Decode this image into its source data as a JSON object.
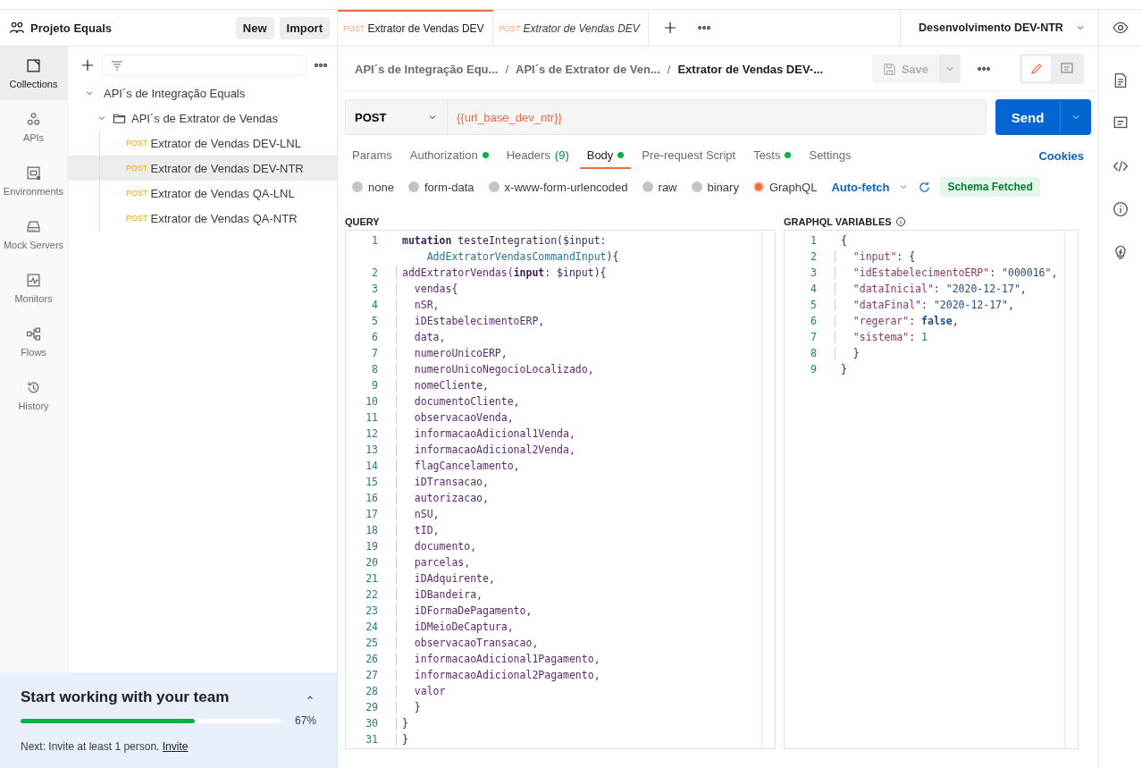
{
  "workspace": {
    "title": "Projeto Equals",
    "buttons": [
      "New",
      "Import"
    ]
  },
  "nav": [
    {
      "label": "Collections",
      "selected": true
    },
    {
      "label": "APIs",
      "selected": false
    },
    {
      "label": "Environments",
      "selected": false
    },
    {
      "label": "Mock Servers",
      "selected": false
    },
    {
      "label": "Monitors",
      "selected": false
    },
    {
      "label": "Flows",
      "selected": false
    },
    {
      "label": "History",
      "selected": false
    }
  ],
  "tree": [
    {
      "kind": "collection",
      "label": "API´s de Integração Equals",
      "expanded": true,
      "children": [
        {
          "kind": "folder",
          "label": "API´s de Extrator de Vendas",
          "expanded": true,
          "children": [
            {
              "kind": "request",
              "method": "POST",
              "label": "Extrator de Vendas DEV-LNL",
              "selected": false
            },
            {
              "kind": "request",
              "method": "POST",
              "label": "Extrator de Vendas DEV-NTR",
              "selected": true
            },
            {
              "kind": "request",
              "method": "POST",
              "label": "Extrator de Vendas QA-LNL",
              "selected": false
            },
            {
              "kind": "request",
              "method": "POST",
              "label": "Extrator de Vendas QA-NTR",
              "selected": false
            }
          ]
        }
      ]
    }
  ],
  "onboarding": {
    "title": "Start working with your team",
    "level": 0.67,
    "percent": "67%",
    "next": "Next: Invite at least 1 person.",
    "link": "Invite"
  },
  "open_tabs": [
    {
      "method": "POST",
      "label": "Extrator de Vendas DEV",
      "selected": true,
      "preview": false
    },
    {
      "method": "POST",
      "label": "Extrator de Vendas DEV",
      "selected": false,
      "preview": true
    }
  ],
  "environment": "Desenvolvimento DEV-NTR",
  "breadcrumb": {
    "items": [
      "API´s de Integração Equ...",
      "API´s de Extrator de Ven...",
      "Extrator de Vendas DEV-..."
    ],
    "separator": "/"
  },
  "save": {
    "label": "Save",
    "disabled": true
  },
  "request": {
    "method": "POST",
    "url": "{{url_base_dev_ntr}}",
    "send": "Send"
  },
  "request_tabs": [
    {
      "label": "Params",
      "dot": false,
      "selected": false
    },
    {
      "label": "Authorization",
      "dot": true,
      "selected": false
    },
    {
      "label": "Headers",
      "count": "(9)",
      "dot": false,
      "selected": false
    },
    {
      "label": "Body",
      "dot": true,
      "selected": true
    },
    {
      "label": "Pre-request Script",
      "dot": false,
      "selected": false
    },
    {
      "label": "Tests",
      "dot": true,
      "selected": false
    },
    {
      "label": "Settings",
      "dot": false,
      "selected": false
    }
  ],
  "cookies": "Cookies",
  "body_types": [
    {
      "label": "none",
      "selected": false
    },
    {
      "label": "form-data",
      "selected": false
    },
    {
      "label": "x-www-form-urlencoded",
      "selected": false
    },
    {
      "label": "raw",
      "selected": false
    },
    {
      "label": "binary",
      "selected": false
    },
    {
      "label": "GraphQL",
      "selected": true
    }
  ],
  "auto_fetch": "Auto-fetch",
  "schema_status": "Schema Fetched",
  "query": {
    "title": "QUERY",
    "lines": [
      {
        "num": "1",
        "segments": [
          {
            "text": "mutation",
            "kind": "keyword"
          },
          {
            "text": " testeIntegration(",
            "kind": "plain"
          },
          {
            "text": "$input",
            "kind": "plain"
          },
          {
            "text": ":",
            "kind": "plain"
          }
        ]
      },
      {
        "segments": [
          {
            "text": "    AddExtratorVendasCommandInput",
            "kind": "type"
          },
          {
            "text": "){",
            "kind": "plain"
          }
        ]
      },
      {
        "num": "2",
        "segments": [
          {
            "text": "addExtratorVendas(",
            "kind": "field"
          },
          {
            "text": "input",
            "kind": "keyword"
          },
          {
            "text": ": $input){",
            "kind": "plain"
          }
        ]
      },
      {
        "num": "3",
        "segments": [
          {
            "text": "  vendas{",
            "kind": "field"
          }
        ]
      },
      {
        "num": "4",
        "segments": [
          {
            "text": "  nSR,",
            "kind": "field"
          }
        ]
      },
      {
        "num": "5",
        "segments": [
          {
            "text": "  iDEstabelecimentoERP,",
            "kind": "field"
          }
        ]
      },
      {
        "num": "6",
        "segments": [
          {
            "text": "  data,",
            "kind": "field"
          }
        ]
      },
      {
        "num": "7",
        "segments": [
          {
            "text": "  numeroUnicoERP,",
            "kind": "field"
          }
        ]
      },
      {
        "num": "8",
        "segments": [
          {
            "text": "  numeroUnicoNegocioLocalizado,",
            "kind": "field"
          }
        ]
      },
      {
        "num": "9",
        "segments": [
          {
            "text": "  nomeCliente,",
            "kind": "field"
          }
        ]
      },
      {
        "num": "10",
        "segments": [
          {
            "text": "  documentoCliente,",
            "kind": "field"
          }
        ]
      },
      {
        "num": "11",
        "segments": [
          {
            "text": "  observacaoVenda,",
            "kind": "field"
          }
        ]
      },
      {
        "num": "12",
        "segments": [
          {
            "text": "  informacaoAdicional1Venda,",
            "kind": "field"
          }
        ]
      },
      {
        "num": "13",
        "segments": [
          {
            "text": "  informacaoAdicional2Venda,",
            "kind": "field"
          }
        ]
      },
      {
        "num": "14",
        "segments": [
          {
            "text": "  flagCancelamento,",
            "kind": "field"
          }
        ]
      },
      {
        "num": "15",
        "segments": [
          {
            "text": "  iDTransacao,",
            "kind": "field"
          }
        ]
      },
      {
        "num": "16",
        "segments": [
          {
            "text": "  autorizacao,",
            "kind": "field"
          }
        ]
      },
      {
        "num": "17",
        "segments": [
          {
            "text": "  nSU,",
            "kind": "field"
          }
        ]
      },
      {
        "num": "18",
        "segments": [
          {
            "text": "  tID,",
            "kind": "field"
          }
        ]
      },
      {
        "num": "19",
        "segments": [
          {
            "text": "  documento,",
            "kind": "field"
          }
        ]
      },
      {
        "num": "20",
        "segments": [
          {
            "text": "  parcelas,",
            "kind": "field"
          }
        ]
      },
      {
        "num": "21",
        "segments": [
          {
            "text": "  iDAdquirente,",
            "kind": "field"
          }
        ]
      },
      {
        "num": "22",
        "segments": [
          {
            "text": "  iDBandeira,",
            "kind": "field"
          }
        ]
      },
      {
        "num": "23",
        "segments": [
          {
            "text": "  iDFormaDePagamento,",
            "kind": "field"
          }
        ]
      },
      {
        "num": "24",
        "segments": [
          {
            "text": "  iDMeioDeCaptura,",
            "kind": "field"
          }
        ]
      },
      {
        "num": "25",
        "segments": [
          {
            "text": "  observacaoTransacao,",
            "kind": "field"
          }
        ]
      },
      {
        "num": "26",
        "segments": [
          {
            "text": "  informacaoAdicional1Pagamento,",
            "kind": "field"
          }
        ]
      },
      {
        "num": "27",
        "segments": [
          {
            "text": "  informacaoAdicional2Pagamento,",
            "kind": "field"
          }
        ]
      },
      {
        "num": "28",
        "segments": [
          {
            "text": "  valor",
            "kind": "field"
          }
        ]
      },
      {
        "num": "29",
        "segments": [
          {
            "text": "  }",
            "kind": "plain"
          }
        ]
      },
      {
        "num": "30",
        "segments": [
          {
            "text": "}",
            "kind": "plain"
          }
        ]
      },
      {
        "num": "31",
        "segments": [
          {
            "text": "}",
            "kind": "plain"
          }
        ]
      }
    ]
  },
  "variables": {
    "title": "GRAPHQL VARIABLES",
    "lines": [
      {
        "num": "1",
        "segments": [
          {
            "text": "{",
            "kind": "plain"
          }
        ]
      },
      {
        "num": "2",
        "segments": [
          {
            "text": "  \"input\"",
            "kind": "key"
          },
          {
            "text": ": {",
            "kind": "plain"
          }
        ]
      },
      {
        "num": "3",
        "segments": [
          {
            "text": "  \"idEstabelecimentoERP\"",
            "kind": "key"
          },
          {
            "text": ": ",
            "kind": "plain"
          },
          {
            "text": "\"000016\"",
            "kind": "string"
          },
          {
            "text": ",",
            "kind": "plain"
          }
        ]
      },
      {
        "num": "4",
        "segments": [
          {
            "text": "  \"dataInicial\"",
            "kind": "key"
          },
          {
            "text": ": ",
            "kind": "plain"
          },
          {
            "text": "\"2020-12-17\"",
            "kind": "string"
          },
          {
            "text": ",",
            "kind": "plain"
          }
        ]
      },
      {
        "num": "5",
        "segments": [
          {
            "text": "  \"dataFinal\"",
            "kind": "key"
          },
          {
            "text": ": ",
            "kind": "plain"
          },
          {
            "text": "\"2020-12-17\"",
            "kind": "string"
          },
          {
            "text": ",",
            "kind": "plain"
          }
        ]
      },
      {
        "num": "6",
        "segments": [
          {
            "text": "  \"regerar\"",
            "kind": "key"
          },
          {
            "text": ": ",
            "kind": "plain"
          },
          {
            "text": "false",
            "kind": "bool"
          },
          {
            "text": ",",
            "kind": "plain"
          }
        ]
      },
      {
        "num": "7",
        "segments": [
          {
            "text": "  \"sistema\"",
            "kind": "key"
          },
          {
            "text": ": ",
            "kind": "plain"
          },
          {
            "text": "1",
            "kind": "number"
          }
        ]
      },
      {
        "num": "8",
        "segments": [
          {
            "text": "  }",
            "kind": "plain"
          }
        ]
      },
      {
        "num": "9",
        "segments": [
          {
            "text": "}",
            "kind": "plain"
          }
        ]
      }
    ]
  }
}
